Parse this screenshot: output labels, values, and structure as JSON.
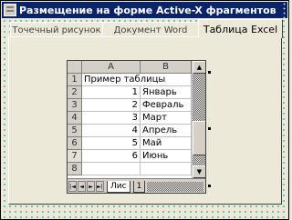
{
  "window": {
    "title": "Размещение на форме Active-X фрагментов"
  },
  "tabs": [
    {
      "label": "Точечный рисунок"
    },
    {
      "label": "Документ Word"
    },
    {
      "label": "Таблица Excel"
    }
  ],
  "sheet": {
    "columns": [
      "A",
      "B"
    ],
    "rows": [
      {
        "num": "1",
        "a": "Пример таблицы",
        "b": ""
      },
      {
        "num": "2",
        "a": "1",
        "b": "Январь"
      },
      {
        "num": "3",
        "a": "2",
        "b": "Февраль"
      },
      {
        "num": "4",
        "a": "3",
        "b": "Март"
      },
      {
        "num": "5",
        "a": "4",
        "b": "Апрель"
      },
      {
        "num": "6",
        "a": "5",
        "b": "Май"
      },
      {
        "num": "7",
        "a": "6",
        "b": "Июнь"
      },
      {
        "num": "8",
        "a": "",
        "b": ""
      }
    ],
    "sheet_tab": "Лис",
    "sheet_tab2": "1",
    "nav": [
      "|◄",
      "◄",
      "►",
      "►|"
    ]
  },
  "icons": {
    "app": "window-app-icon",
    "scroll_up": "▲",
    "scroll_down": "▼"
  }
}
